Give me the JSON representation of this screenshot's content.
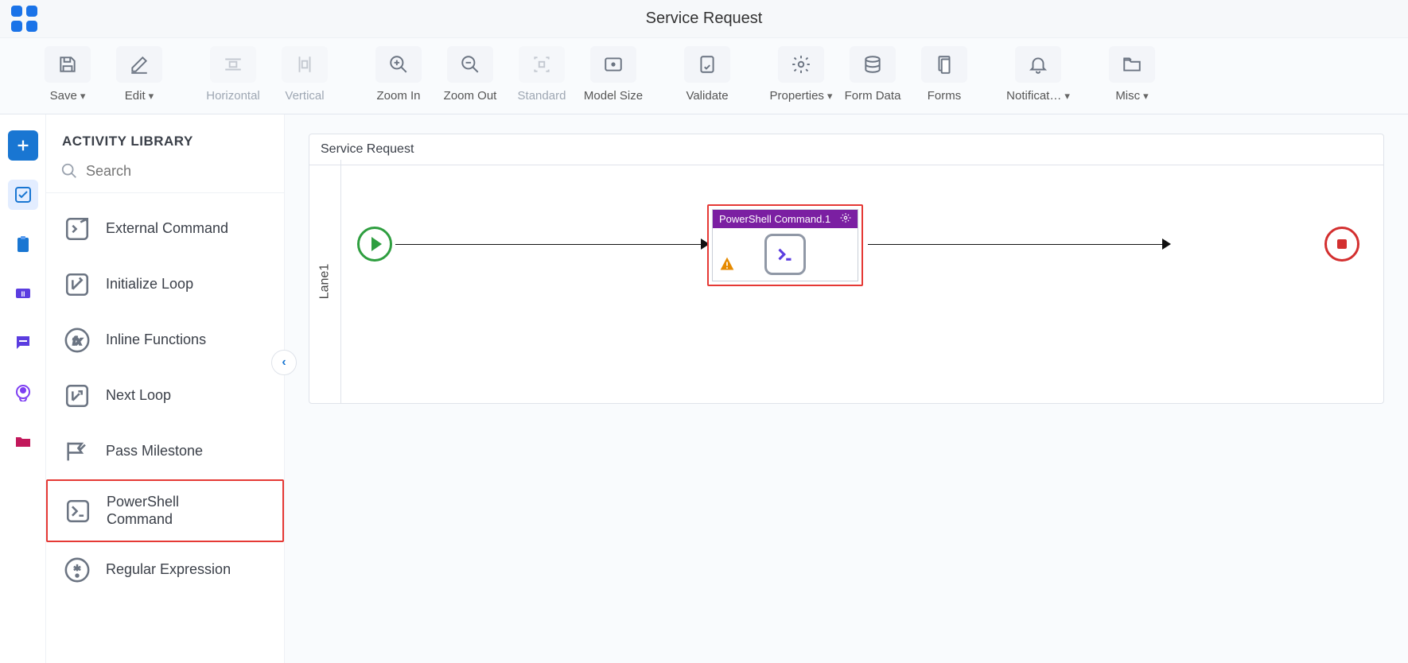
{
  "header": {
    "title": "Service Request"
  },
  "toolbar": {
    "save": "Save",
    "edit": "Edit",
    "horizontal": "Horizontal",
    "vertical": "Vertical",
    "zoom_in": "Zoom In",
    "zoom_out": "Zoom Out",
    "standard": "Standard",
    "model_size": "Model Size",
    "validate": "Validate",
    "properties": "Properties",
    "form_data": "Form Data",
    "forms": "Forms",
    "notifications": "Notificat…",
    "misc": "Misc"
  },
  "sidebar": {
    "title": "ACTIVITY LIBRARY",
    "search_placeholder": "Search",
    "items": [
      {
        "label": "External Command"
      },
      {
        "label": "Initialize Loop"
      },
      {
        "label": "Inline Functions"
      },
      {
        "label": "Next Loop"
      },
      {
        "label": "Pass Milestone"
      },
      {
        "label": "PowerShell Command",
        "selected": true
      },
      {
        "label": "Regular Expression"
      }
    ]
  },
  "canvas": {
    "title": "Service Request",
    "lane": "Lane1",
    "activity": {
      "title": "PowerShell Command.1"
    }
  }
}
